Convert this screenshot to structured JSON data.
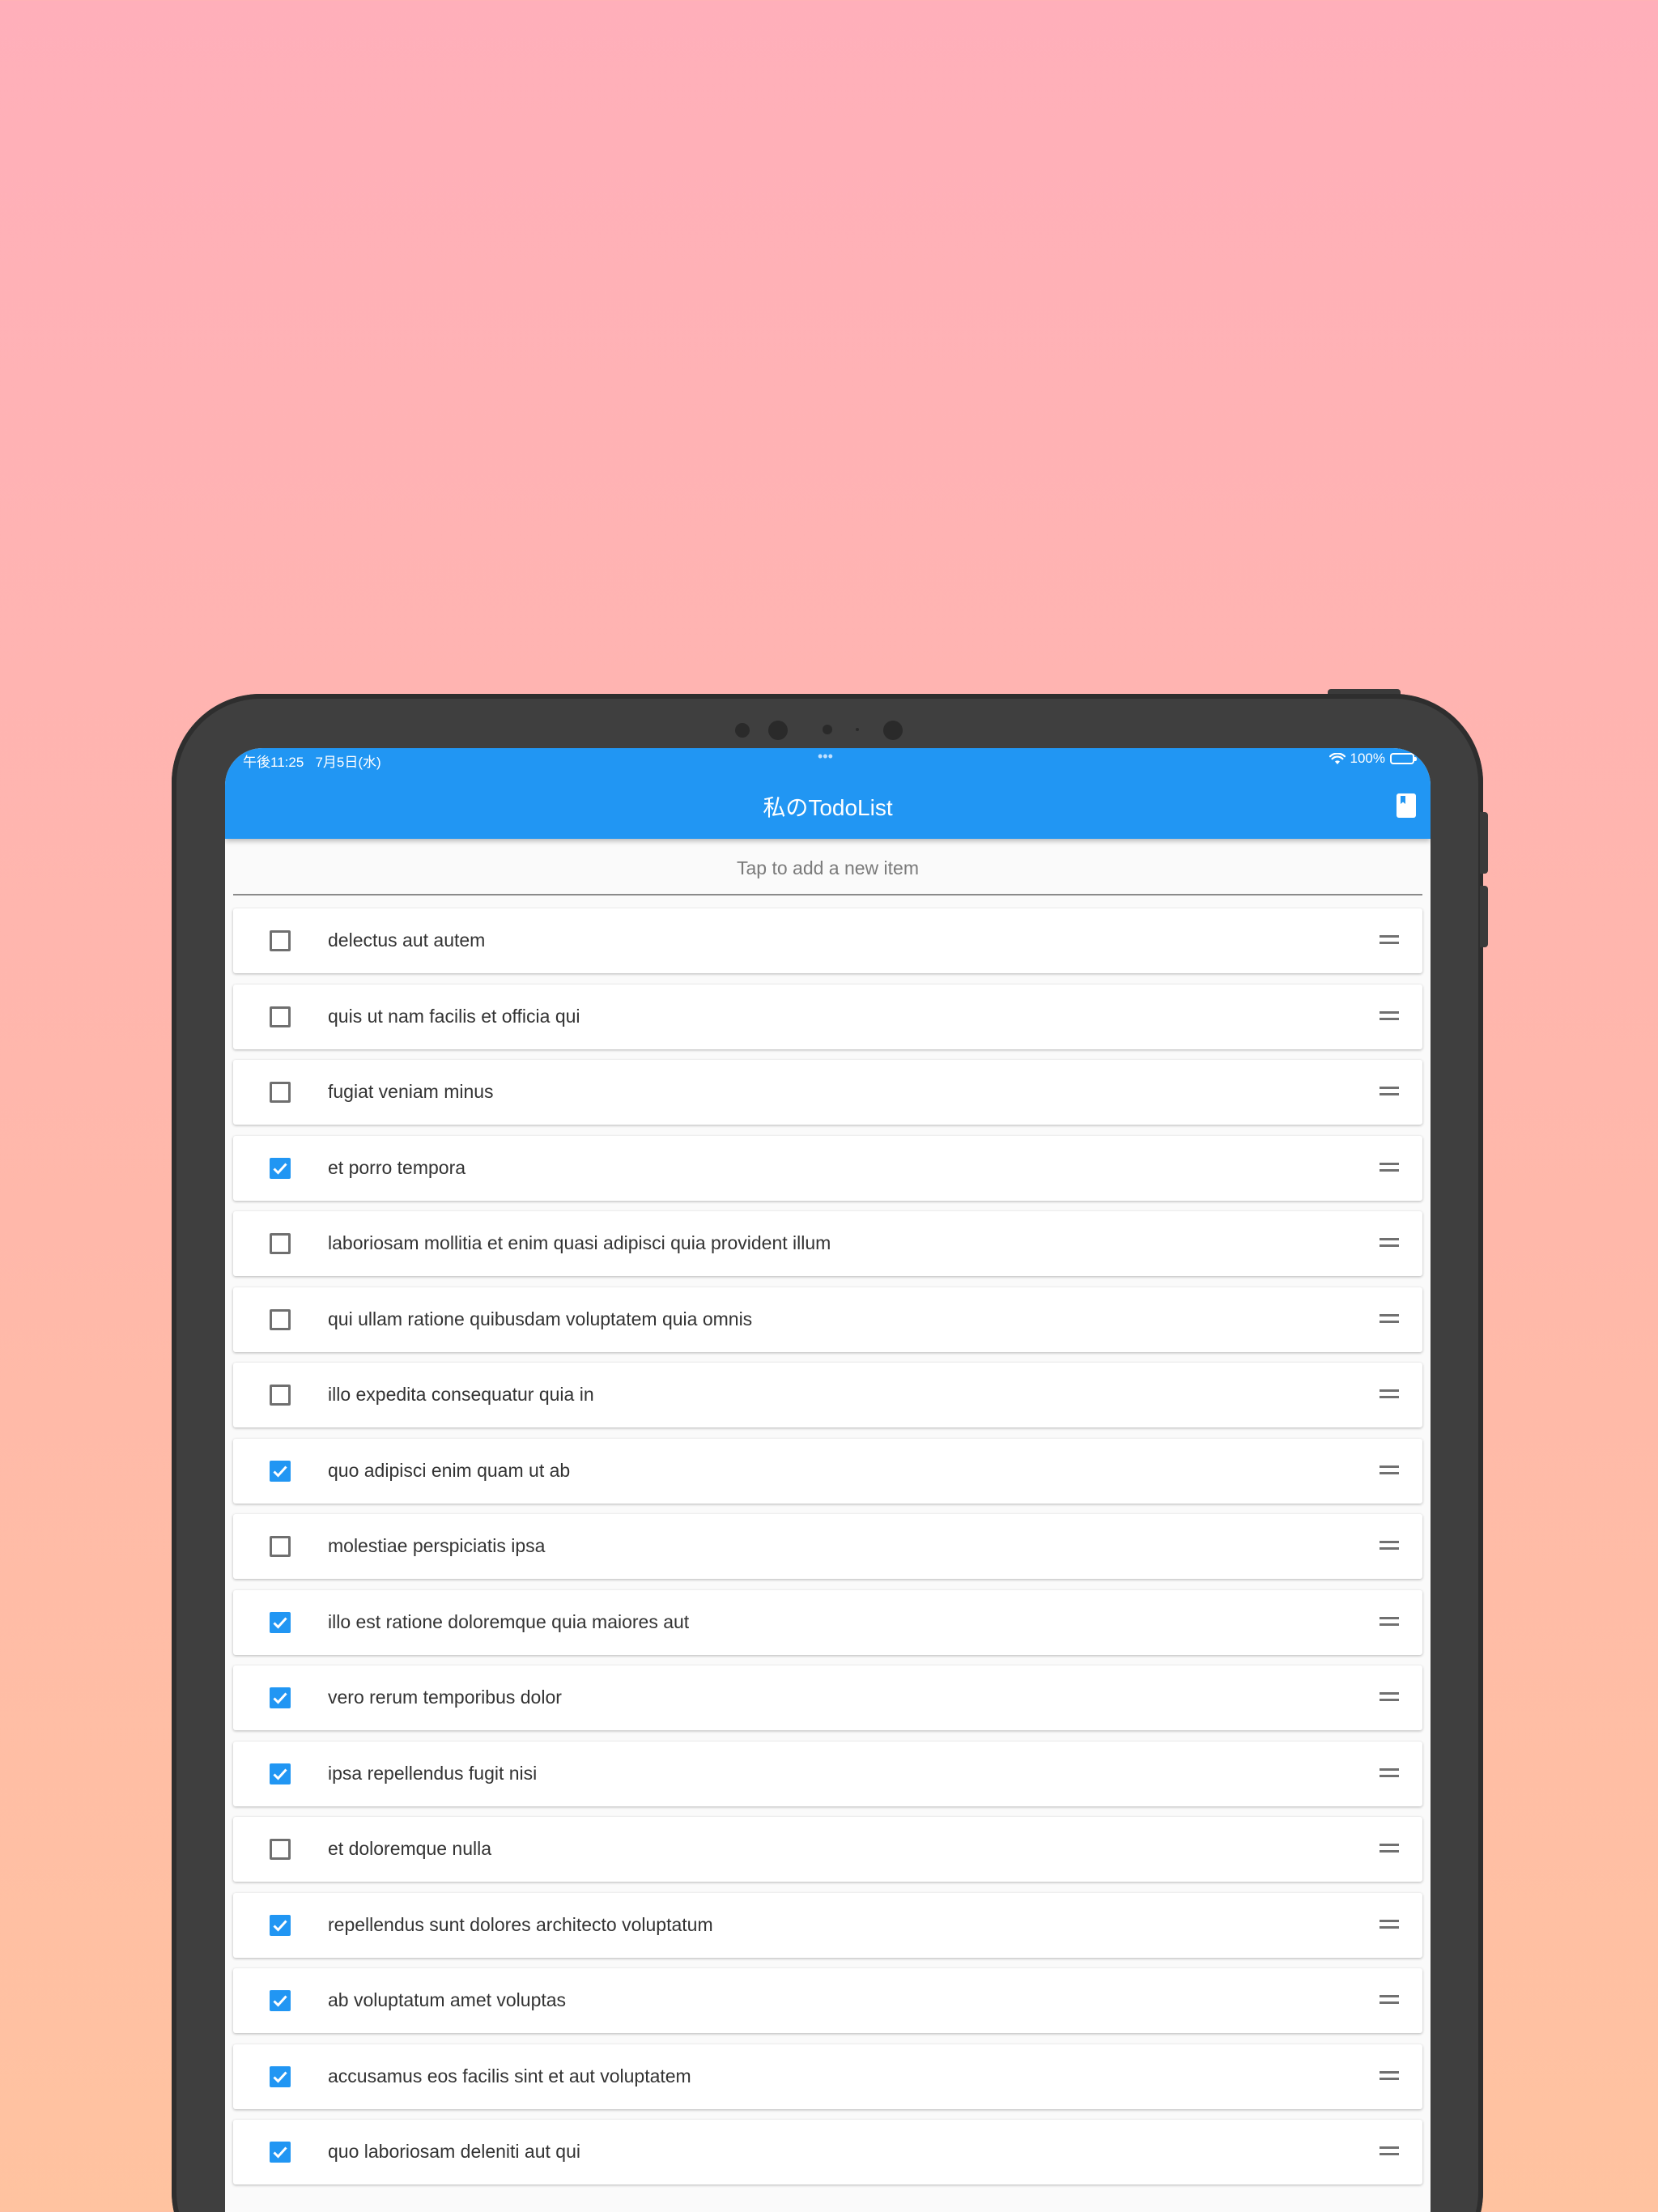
{
  "status_bar": {
    "time": "午後11:25   7月5日(水)",
    "battery": "100%"
  },
  "app_bar": {
    "title": "私のTodoList",
    "action_icon": "book-icon"
  },
  "new_item": {
    "placeholder": "Tap to add a new item"
  },
  "colors": {
    "accent": "#2196f3",
    "unchecked_border": "#6f6f6f"
  },
  "todos": [
    {
      "label": "delectus aut autem",
      "checked": false
    },
    {
      "label": "quis ut nam facilis et officia qui",
      "checked": false
    },
    {
      "label": "fugiat veniam minus",
      "checked": false
    },
    {
      "label": "et porro tempora",
      "checked": true
    },
    {
      "label": "laboriosam mollitia et enim quasi adipisci quia provident illum",
      "checked": false
    },
    {
      "label": "qui ullam ratione quibusdam voluptatem quia omnis",
      "checked": false
    },
    {
      "label": "illo expedita consequatur quia in",
      "checked": false
    },
    {
      "label": "quo adipisci enim quam ut ab",
      "checked": true
    },
    {
      "label": "molestiae perspiciatis ipsa",
      "checked": false
    },
    {
      "label": "illo est ratione doloremque quia maiores aut",
      "checked": true
    },
    {
      "label": "vero rerum temporibus dolor",
      "checked": true
    },
    {
      "label": "ipsa repellendus fugit nisi",
      "checked": true
    },
    {
      "label": "et doloremque nulla",
      "checked": false
    },
    {
      "label": "repellendus sunt dolores architecto voluptatum",
      "checked": true
    },
    {
      "label": "ab voluptatum amet voluptas",
      "checked": true
    },
    {
      "label": "accusamus eos facilis sint et aut voluptatem",
      "checked": true
    },
    {
      "label": "quo laboriosam deleniti aut qui",
      "checked": true
    }
  ]
}
